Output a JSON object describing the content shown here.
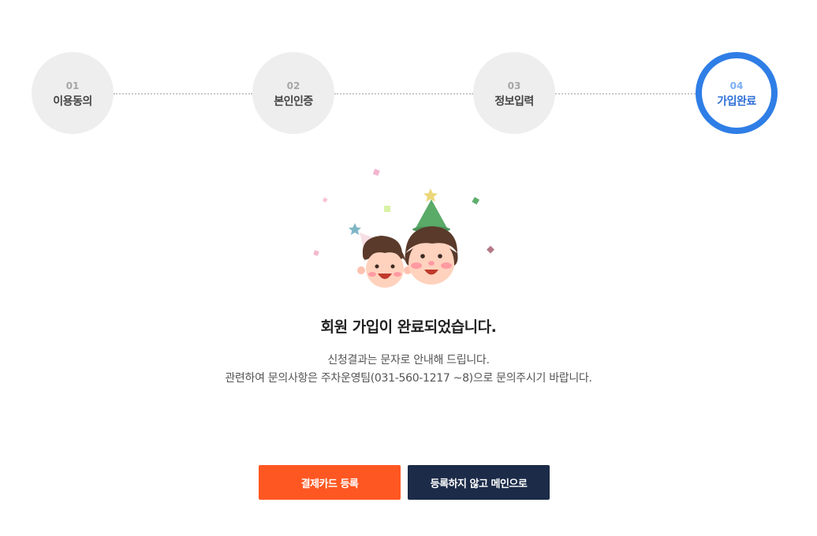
{
  "steps": [
    {
      "num": "01",
      "label": "이용동의",
      "state": "inactive"
    },
    {
      "num": "02",
      "label": "본인인증",
      "state": "inactive"
    },
    {
      "num": "03",
      "label": "정보입력",
      "state": "inactive"
    },
    {
      "num": "04",
      "label": "가입완료",
      "state": "active"
    }
  ],
  "colors": {
    "active_step": "#2f7ee6",
    "primary_button": "#ff5722",
    "secondary_button": "#1b2b48"
  },
  "result": {
    "title": "회원 가입이 완료되었습니다.",
    "line1": "신청결과는 문자로 안내해 드립니다.",
    "line2": "관련하여 문의사항은 주차운영팀(031-560-1217 ~8)으로 문의주시기 바랍니다."
  },
  "actions": {
    "register_card": "결제카드 등록",
    "skip_to_main": "등록하지 않고 메인으로"
  },
  "illustration": {
    "name": "celebration-kids-icon"
  }
}
